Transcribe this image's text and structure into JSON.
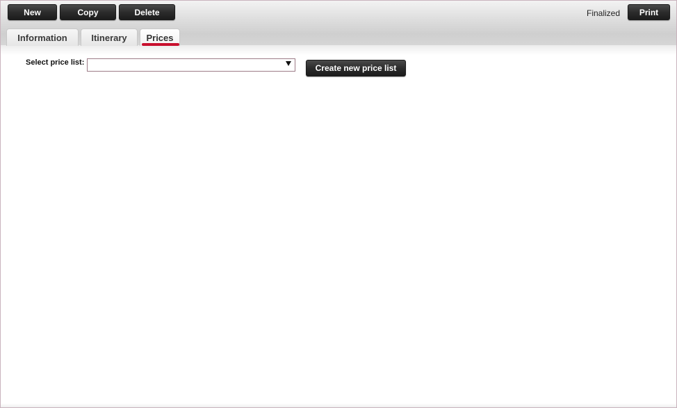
{
  "toolbar": {
    "new_label": "New",
    "copy_label": "Copy",
    "delete_label": "Delete",
    "status": "Finalized",
    "print_label": "Print"
  },
  "tabs": [
    {
      "label": "Information",
      "active": false
    },
    {
      "label": "Itinerary",
      "active": false
    },
    {
      "label": "Prices",
      "active": true
    }
  ],
  "prices": {
    "select_label": "Select price list:",
    "selected_value": "",
    "create_button_label": "Create new price list"
  },
  "colors": {
    "active_tab_indicator": "#c8102e",
    "button_bg": "#2c2c2c"
  }
}
